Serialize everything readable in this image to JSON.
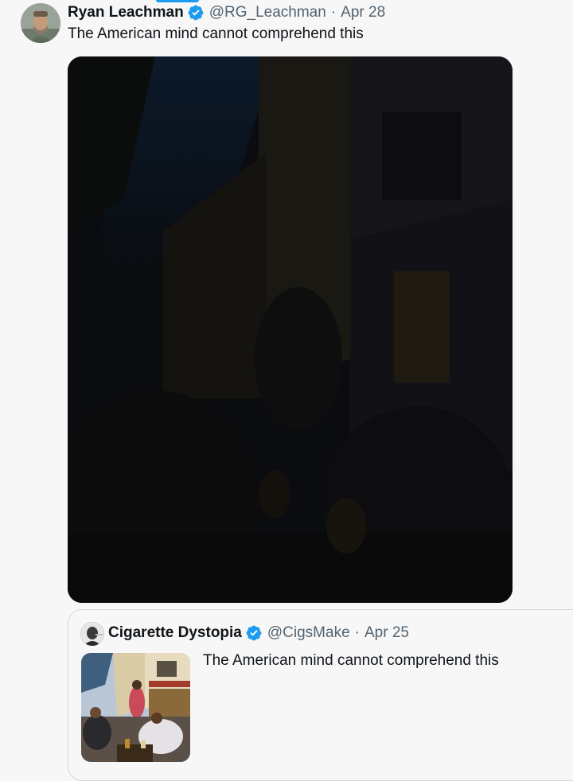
{
  "tweet": {
    "author_name": "Ryan Leachman",
    "handle": "@RG_Leachman",
    "separator": "·",
    "date": "Apr 28",
    "text": "The American mind cannot comprehend this",
    "verified_icon": "verified-badge-icon",
    "media_description_icon": "photo-icon"
  },
  "quoted_tweet": {
    "author_name": "Cigarette Dystopia",
    "handle": "@CigsMake",
    "separator": "·",
    "date": "Apr 25",
    "text": "The American mind cannot comprehend this"
  },
  "colors": {
    "accent": "#1d9bf0",
    "text_primary": "#0f1419",
    "text_secondary": "#536471",
    "border": "#cfd9de",
    "background": "#f7f7f7"
  }
}
